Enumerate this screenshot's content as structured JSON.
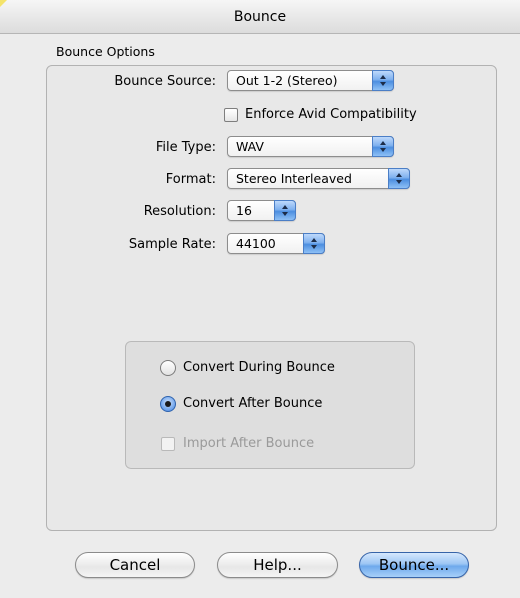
{
  "window": {
    "title": "Bounce"
  },
  "group": {
    "label": "Bounce Options"
  },
  "fields": {
    "bounce_source": {
      "label": "Bounce Source:",
      "value": "Out 1-2 (Stereo)"
    },
    "enforce_avid": {
      "label": "Enforce Avid Compatibility",
      "checked": false
    },
    "file_type": {
      "label": "File Type:",
      "value": "WAV"
    },
    "format": {
      "label": "Format:",
      "value": "Stereo Interleaved"
    },
    "resolution": {
      "label": "Resolution:",
      "value": "16"
    },
    "sample_rate": {
      "label": "Sample Rate:",
      "value": "44100"
    }
  },
  "conversion": {
    "during": {
      "label": "Convert During Bounce",
      "selected": false
    },
    "after": {
      "label": "Convert After Bounce",
      "selected": true
    },
    "import_after": {
      "label": "Import After Bounce",
      "checked": false,
      "enabled": false
    }
  },
  "buttons": {
    "cancel": "Cancel",
    "help": "Help...",
    "bounce": "Bounce..."
  },
  "colors": {
    "accent": "#6ea9ec",
    "window_bg": "#ececec"
  }
}
